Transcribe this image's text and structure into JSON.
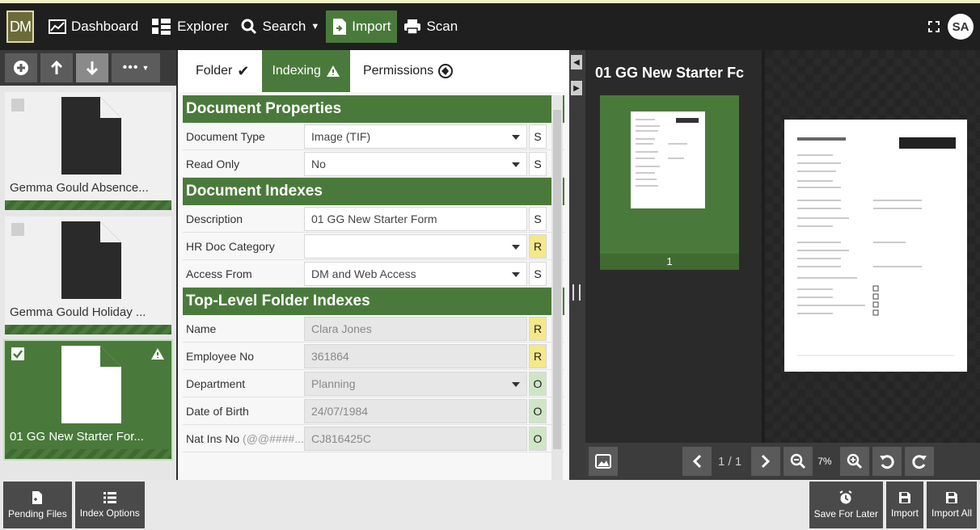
{
  "app": {
    "logo": "DM"
  },
  "nav": {
    "dashboard": "Dashboard",
    "explorer": "Explorer",
    "search": "Search",
    "import": "Import",
    "scan": "Scan"
  },
  "user": {
    "initials": "SA"
  },
  "documents": [
    {
      "title": "Gemma Gould Absence...",
      "checked": false,
      "selected": false
    },
    {
      "title": "Gemma Gould Holiday ...",
      "checked": false,
      "selected": false
    },
    {
      "title": "01 GG New Starter For...",
      "checked": true,
      "selected": true,
      "warning": true
    }
  ],
  "tabs": {
    "folder": "Folder",
    "indexing": "Indexing",
    "permissions": "Permissions"
  },
  "sections": {
    "doc_props": "Document Properties",
    "doc_indexes": "Document Indexes",
    "top_level": "Top-Level Folder Indexes"
  },
  "doc_props": {
    "document_type": {
      "label": "Document Type",
      "value": "Image (TIF)",
      "badge": "S"
    },
    "read_only": {
      "label": "Read Only",
      "value": "No",
      "badge": "S"
    }
  },
  "doc_indexes": {
    "description": {
      "label": "Description",
      "value": "01 GG New Starter Form",
      "badge": "S"
    },
    "hr_doc_category": {
      "label": "HR Doc Category",
      "value": "",
      "badge": "R"
    },
    "access_from": {
      "label": "Access From",
      "value": "DM and Web Access",
      "badge": "S"
    }
  },
  "top_level": {
    "name": {
      "label": "Name",
      "value": "Clara Jones",
      "badge": "R"
    },
    "employee_no": {
      "label": "Employee No",
      "value": "361864",
      "badge": "R"
    },
    "department": {
      "label": "Department",
      "value": "Planning",
      "badge": "O"
    },
    "dob": {
      "label": "Date of Birth",
      "value": "24/07/1984",
      "badge": "O"
    },
    "nat_ins": {
      "label": "Nat Ins No",
      "hint": "(@@####...",
      "value": "CJ816425C",
      "badge": "O"
    }
  },
  "viewer": {
    "title": "01 GG New Starter Fc",
    "thumb_page": "1",
    "page_indicator": "1 / 1",
    "zoom": "7%"
  },
  "bottom": {
    "pending_files": "Pending Files",
    "index_options": "Index Options",
    "save_for_later": "Save For Later",
    "import": "Import",
    "import_all": "Import All"
  }
}
